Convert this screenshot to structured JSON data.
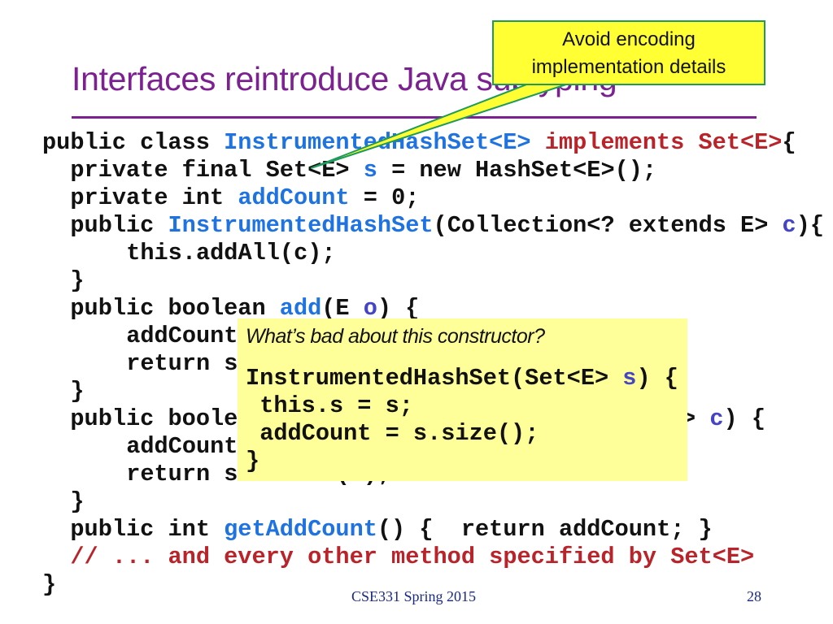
{
  "slide": {
    "title": "Interfaces reintroduce Java subtyping",
    "footer_course": "CSE331 Spring 2015",
    "page_number": "28"
  },
  "colors": {
    "title": "#7b2190",
    "identifier_blue": "#1f73e0",
    "keyword_red": "#b8242a",
    "variable": "#4444c4",
    "note_background": "#ffff99",
    "callout_background": "#ffff33",
    "callout_border": "#1e9a5a"
  },
  "code_lines": [
    {
      "indent": 0,
      "tokens": [
        [
          "public class ",
          "kw"
        ],
        [
          "InstrumentedHashSet<E>",
          "blue"
        ],
        [
          " ",
          "kw"
        ],
        [
          "implements Set<E>",
          "red"
        ],
        [
          "{",
          "kw"
        ]
      ]
    },
    {
      "indent": 2,
      "tokens": [
        [
          "private final Set<E> ",
          "kw"
        ],
        [
          "s",
          "blue"
        ],
        [
          " = new HashSet<E>();",
          "kw"
        ]
      ]
    },
    {
      "indent": 2,
      "tokens": [
        [
          "private int ",
          "kw"
        ],
        [
          "addCount",
          "blue"
        ],
        [
          " = 0;",
          "kw"
        ]
      ]
    },
    {
      "indent": 2,
      "tokens": [
        [
          "public ",
          "kw"
        ],
        [
          "InstrumentedHashSet",
          "blue"
        ],
        [
          "(Collection<? extends E> ",
          "kw"
        ],
        [
          "c",
          "var"
        ],
        [
          "){",
          "kw"
        ]
      ]
    },
    {
      "indent": 6,
      "tokens": [
        [
          "this.addAll(c);",
          "kw"
        ]
      ]
    },
    {
      "indent": 2,
      "tokens": [
        [
          "}",
          "kw"
        ]
      ]
    },
    {
      "indent": 2,
      "tokens": [
        [
          "public boolean ",
          "kw"
        ],
        [
          "add",
          "blue"
        ],
        [
          "(E ",
          "kw"
        ],
        [
          "o",
          "var"
        ],
        [
          ") {",
          "kw"
        ]
      ]
    },
    {
      "indent": 6,
      "tokens": [
        [
          "addCount",
          "kw"
        ]
      ]
    },
    {
      "indent": 6,
      "tokens": [
        [
          "return s",
          "kw"
        ]
      ]
    },
    {
      "indent": 2,
      "tokens": [
        [
          "}",
          "kw"
        ]
      ]
    },
    {
      "indent": 2,
      "tokens": [
        [
          "public boole",
          "kw"
        ]
      ],
      "suffix": [
        [
          "> ",
          "kw"
        ],
        [
          "c",
          "var"
        ],
        [
          ") {",
          "kw"
        ]
      ]
    },
    {
      "indent": 6,
      "tokens": [
        [
          "addCount",
          "kw"
        ]
      ]
    },
    {
      "indent": 6,
      "tokens": [
        [
          "return s.addAll(c);",
          "kw"
        ]
      ]
    },
    {
      "indent": 2,
      "tokens": [
        [
          "}",
          "kw"
        ]
      ]
    },
    {
      "indent": 2,
      "tokens": [
        [
          "public int ",
          "kw"
        ],
        [
          "getAddCount",
          "blue"
        ],
        [
          "() {  return addCount; }",
          "kw"
        ]
      ]
    },
    {
      "indent": 2,
      "tokens": [
        [
          "// ... and every other method specified by Set<E>",
          "red"
        ]
      ]
    },
    {
      "indent": 0,
      "tokens": [
        [
          "}",
          "kw"
        ]
      ]
    }
  ],
  "note": {
    "question": "What’s bad  about this constructor?",
    "code_lines": [
      {
        "indent": 0,
        "tokens": [
          [
            "InstrumentedHashSet(Set<E> ",
            "kw"
          ],
          [
            "s",
            "var"
          ],
          [
            ") {",
            "kw"
          ]
        ]
      },
      {
        "indent": 1,
        "tokens": [
          [
            "this.s = s;",
            "kw"
          ]
        ]
      },
      {
        "indent": 1,
        "tokens": [
          [
            "addCount = s.size();",
            "kw"
          ]
        ]
      },
      {
        "indent": 0,
        "tokens": [
          [
            "}",
            "kw"
          ]
        ]
      }
    ]
  },
  "callout": {
    "line1": "Avoid encoding",
    "line2": "implementation details"
  }
}
